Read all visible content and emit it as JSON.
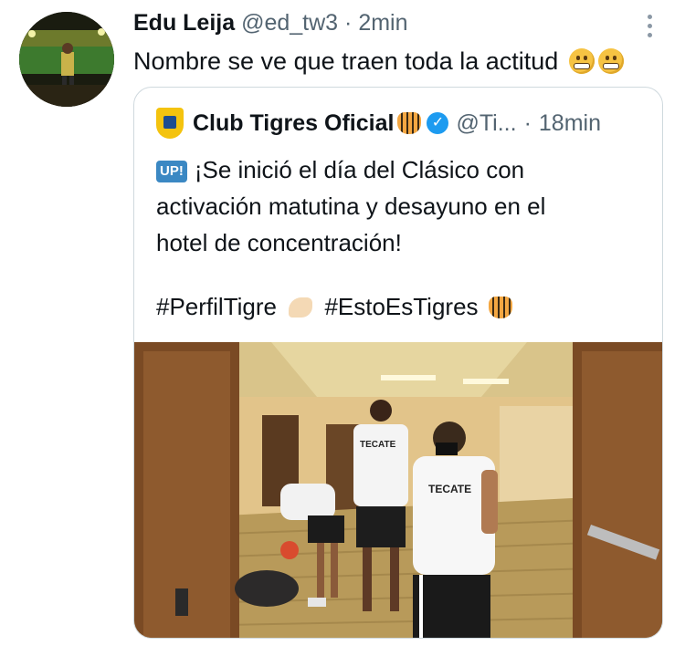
{
  "tweet": {
    "author_name": "Edu Leija",
    "author_handle": "@ed_tw3",
    "separator": "·",
    "time": "2min",
    "text": "Nombre se ve que traen toda la actitud",
    "emojis": [
      "grimacing-face-emoji",
      "grimacing-face-emoji"
    ]
  },
  "quoted_tweet": {
    "author_name": "Club Tigres Oficial",
    "author_handle": "@Ti...",
    "separator": "·",
    "time": "18min",
    "badge": "UP!",
    "text_lines": [
      "¡Se inició el día del Clásico con",
      "activación matutina y desayuno en el",
      "hotel de concentración!"
    ],
    "hashtag_1": "#PerfilTigre",
    "hashtag_2": "#EstoEsTigres",
    "image_labels": {
      "jersey_sponsor_1": "TECATE",
      "jersey_sponsor_2": "TECATE"
    }
  },
  "colors": {
    "text": "#0f1419",
    "muted": "#536471",
    "verified": "#1d9bf0",
    "border": "#cfd9de"
  }
}
